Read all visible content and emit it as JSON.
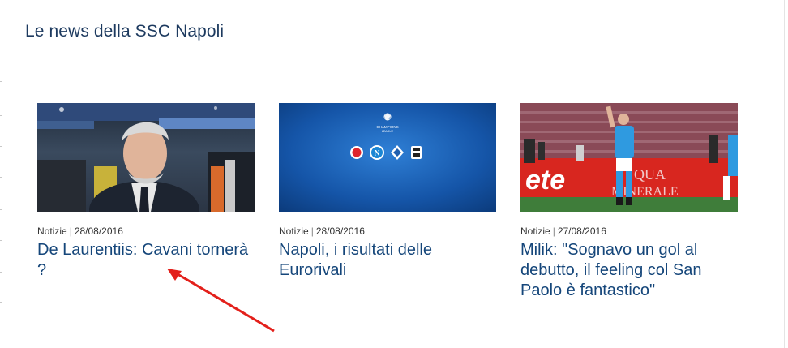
{
  "section": {
    "title": "Le news della SSC Napoli"
  },
  "cards": [
    {
      "category": "Notizie",
      "date": "28/08/2016",
      "headline": "De Laurentiis: Cavani tornerà ?",
      "image_subject": "president-portrait-photo"
    },
    {
      "category": "Notizie",
      "date": "28/08/2016",
      "headline": "Napoli, i risultati delle Eurorivali",
      "image_subject": "champions-league-badges-graphic"
    },
    {
      "category": "Notizie",
      "date": "27/08/2016",
      "headline": "Milik: \"Sognavo un gol al debutto, il feeling col San Paolo è fantastico\"",
      "image_subject": "player-celebration-photo"
    }
  ],
  "colors": {
    "title": "#1d3a5f",
    "headline_link": "#15467a",
    "annotation_arrow": "#e3201b"
  }
}
